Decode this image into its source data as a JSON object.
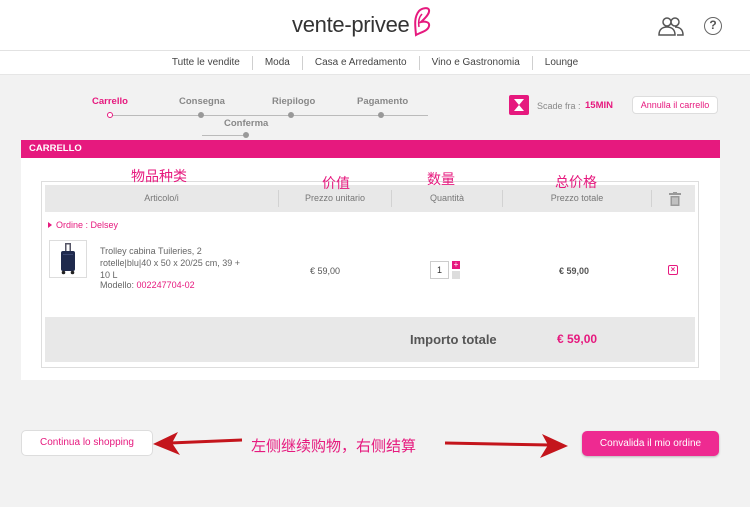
{
  "header": {
    "logo_text": "vente-privee"
  },
  "nav": {
    "items": [
      "Tutte le vendite",
      "Moda",
      "Casa e Arredamento",
      "Vino e Gastronomia",
      "Lounge"
    ]
  },
  "steps": {
    "items": [
      "Carrello",
      "Consegna",
      "Riepilogo",
      "Pagamento",
      "Conferma"
    ],
    "active": "Carrello"
  },
  "timer": {
    "label": "Scade fra :",
    "value": "15MIN",
    "cancel_label": "Annulla il carrello"
  },
  "cart": {
    "title": "CARRELLO",
    "columns": [
      "Articolo/i",
      "Prezzo unitario",
      "Quantità",
      "Prezzo totale"
    ],
    "order_label": "Ordine : Delsey",
    "item": {
      "name": "Trolley cabina Tuileries, 2 rotelle|blu|40 x 50 x 20/25 cm, 39 + 10 L",
      "model_label": "Modello:",
      "model_code": "002247704-02",
      "unit_price": "€ 59,00",
      "quantity": "1",
      "total": "€ 59,00"
    },
    "total_label": "Importo totale",
    "total_value": "€ 59,00"
  },
  "annotations": {
    "category": "物品种类",
    "price": "价值",
    "quantity": "数量",
    "total": "总价格",
    "footer": "左侧继续购物，右侧结算"
  },
  "actions": {
    "continue_label": "Continua lo shopping",
    "validate_label": "Convalida il mio ordine"
  },
  "colors": {
    "accent": "#e6197e",
    "annotation_red": "#c4151c"
  }
}
